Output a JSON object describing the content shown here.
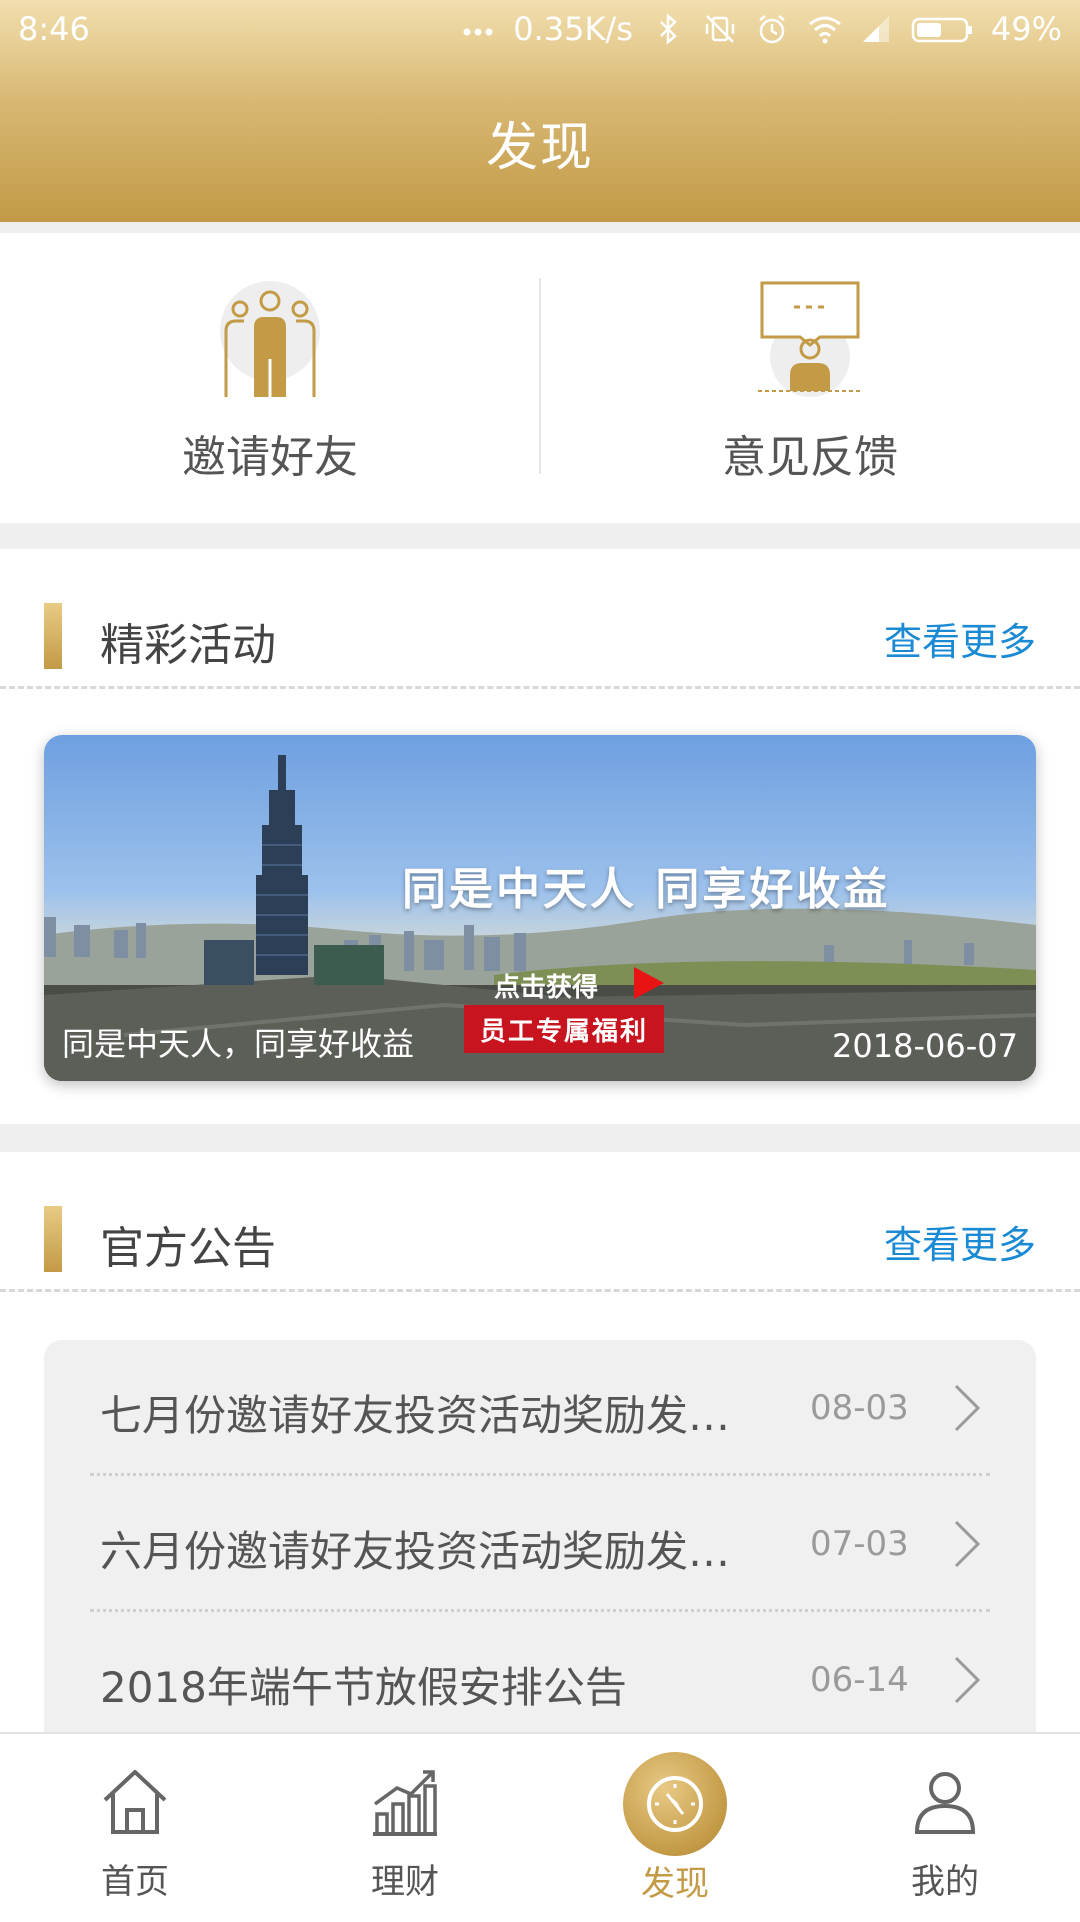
{
  "status": {
    "time": "8:46",
    "speed": "0.35K/s",
    "battery": "49%",
    "icons": [
      "dots-icon",
      "bluetooth-icon",
      "vibrate-off-icon",
      "alarm-icon",
      "wifi-icon",
      "signal-icon",
      "battery-icon"
    ]
  },
  "header": {
    "title": "发现"
  },
  "quick_actions": [
    {
      "label": "邀请好友",
      "icon": "invite-friends-icon"
    },
    {
      "label": "意见反馈",
      "icon": "feedback-icon"
    }
  ],
  "activities": {
    "title": "精彩活动",
    "more": "查看更多",
    "banner": {
      "slogan": "同是中天人  同享好收益",
      "click_text": "点击获得",
      "benefit_text": "员工专属福利",
      "caption": "同是中天人，同享好收益",
      "date": "2018-06-07"
    }
  },
  "announcements": {
    "title": "官方公告",
    "more": "查看更多",
    "items": [
      {
        "title": "七月份邀请好友投资活动奖励发…",
        "date": "08-03"
      },
      {
        "title": "六月份邀请好友投资活动奖励发…",
        "date": "07-03"
      },
      {
        "title": "2018年端午节放假安排公告",
        "date": "06-14"
      }
    ]
  },
  "tabs": [
    {
      "label": "首页",
      "icon": "home-icon",
      "active": false
    },
    {
      "label": "理财",
      "icon": "chart-icon",
      "active": false
    },
    {
      "label": "发现",
      "icon": "compass-icon",
      "active": true
    },
    {
      "label": "我的",
      "icon": "user-icon",
      "active": false
    }
  ],
  "colors": {
    "gold": "#c39a46",
    "link": "#1a8ad4"
  }
}
